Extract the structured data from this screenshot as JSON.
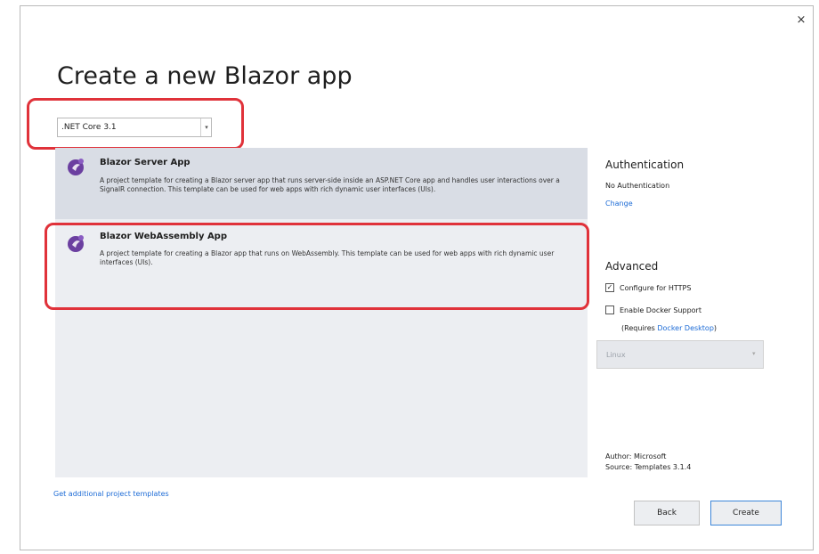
{
  "dialog": {
    "title": "Create a new Blazor app",
    "close_label": "×"
  },
  "framework": {
    "selected": ".NET Core 3.1",
    "arrow": "▾"
  },
  "templates": [
    {
      "name": "Blazor Server App",
      "description": "A project template for creating a Blazor server app that runs server-side inside an ASP.NET Core app and handles user interactions over a SignalR connection. This template can be used for web apps with rich dynamic user interfaces (UIs).",
      "selected": true
    },
    {
      "name": "Blazor WebAssembly App",
      "description": "A project template for creating a Blazor app that runs on WebAssembly. This template can be used for web apps with rich dynamic user interfaces (UIs).",
      "selected": false
    }
  ],
  "authentication": {
    "heading": "Authentication",
    "value": "No Authentication",
    "change_label": "Change"
  },
  "advanced": {
    "heading": "Advanced",
    "https_label": "Configure for HTTPS",
    "https_checked": true,
    "docker_label": "Enable Docker Support",
    "docker_checked": false,
    "requires_prefix": "(Requires ",
    "requires_link": "Docker Desktop",
    "requires_suffix": ")",
    "os_value": "Linux",
    "os_arrow": "▾"
  },
  "meta": {
    "author": "Author: Microsoft",
    "source": "Source: Templates 3.1.4"
  },
  "footer": {
    "additional_templates_link": "Get additional project templates",
    "back_label": "Back",
    "create_label": "Create"
  },
  "colors": {
    "accent": "#1c6bd6",
    "highlight": "#e0323a",
    "icon_purple": "#6b3fa0"
  }
}
